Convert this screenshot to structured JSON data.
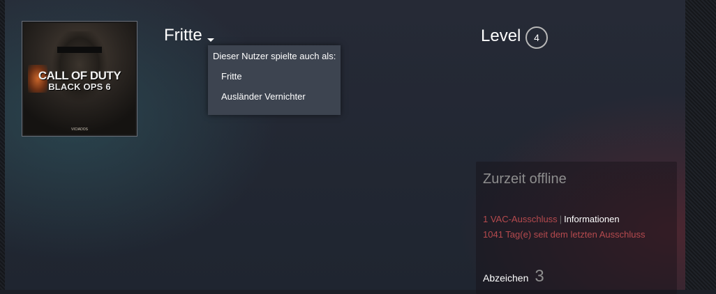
{
  "profile": {
    "persona_name": "Fritte",
    "avatar": {
      "title_line1": "CALL OF DUTY",
      "title_line2": "BLACK OPS 6",
      "watermark": "VICIADOS"
    },
    "alias_popup": {
      "header": "Dieser Nutzer spielte auch als:",
      "aliases": [
        "Fritte",
        "Ausländer Vernichter"
      ]
    },
    "level": {
      "label": "Level",
      "value": "4"
    }
  },
  "status": {
    "title": "Zurzeit offline",
    "vac_count": "1 VAC-Ausschluss",
    "vac_separator": "|",
    "vac_info_link": "Informationen",
    "vac_days": "1041 Tag(e) seit dem letzten Ausschluss"
  },
  "badges": {
    "label": "Abzeichen",
    "count": "3"
  },
  "colors": {
    "ban_red": "#b64a4e",
    "popup_bg": "#3d4450",
    "muted_text": "#8e8e8e"
  }
}
